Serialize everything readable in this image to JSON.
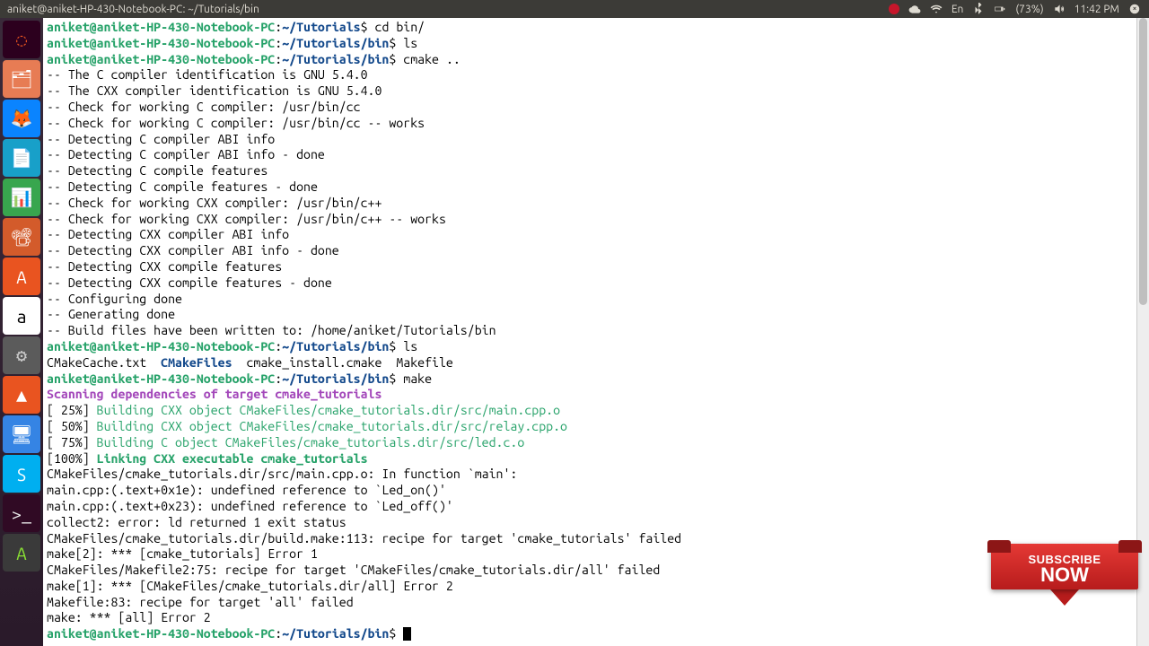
{
  "topbar": {
    "title": "aniket@aniket-HP-430-Notebook-PC: ~/Tutorials/bin",
    "lang": "En",
    "battery": "(73%)",
    "time": "11:42 PM"
  },
  "prompt": {
    "userhost": "aniket@aniket-HP-430-Notebook-PC",
    "sep": ":",
    "path1": "~/Tutorials",
    "path2": "~/Tutorials/bin",
    "dollar": "$"
  },
  "cmds": {
    "cd": " cd bin/",
    "ls": " ls",
    "cmake": " cmake ..",
    "make": " make"
  },
  "cmake_lines": [
    "-- The C compiler identification is GNU 5.4.0",
    "-- The CXX compiler identification is GNU 5.4.0",
    "-- Check for working C compiler: /usr/bin/cc",
    "-- Check for working C compiler: /usr/bin/cc -- works",
    "-- Detecting C compiler ABI info",
    "-- Detecting C compiler ABI info - done",
    "-- Detecting C compile features",
    "-- Detecting C compile features - done",
    "-- Check for working CXX compiler: /usr/bin/c++",
    "-- Check for working CXX compiler: /usr/bin/c++ -- works",
    "-- Detecting CXX compiler ABI info",
    "-- Detecting CXX compiler ABI info - done",
    "-- Detecting CXX compile features",
    "-- Detecting CXX compile features - done",
    "-- Configuring done",
    "-- Generating done",
    "-- Build files have been written to: /home/aniket/Tutorials/bin"
  ],
  "ls_out": {
    "a": "CMakeCache.txt  ",
    "b": "CMakeFiles",
    "c": "  cmake_install.cmake  Makefile"
  },
  "make": {
    "scan": "Scanning dependencies of target cmake_tutorials",
    "p25a": "[ 25%] ",
    "p25b": "Building CXX object CMakeFiles/cmake_tutorials.dir/src/main.cpp.o",
    "p50a": "[ 50%] ",
    "p50b": "Building CXX object CMakeFiles/cmake_tutorials.dir/src/relay.cpp.o",
    "p75a": "[ 75%] ",
    "p75b": "Building C object CMakeFiles/cmake_tutorials.dir/src/led.c.o",
    "p100a": "[100%] ",
    "p100b": "Linking CXX executable cmake_tutorials"
  },
  "errors": [
    "CMakeFiles/cmake_tutorials.dir/src/main.cpp.o: In function `main':",
    "main.cpp:(.text+0x1e): undefined reference to `Led_on()'",
    "main.cpp:(.text+0x23): undefined reference to `Led_off()'",
    "collect2: error: ld returned 1 exit status",
    "CMakeFiles/cmake_tutorials.dir/build.make:113: recipe for target 'cmake_tutorials' failed",
    "make[2]: *** [cmake_tutorials] Error 1",
    "CMakeFiles/Makefile2:75: recipe for target 'CMakeFiles/cmake_tutorials.dir/all' failed",
    "make[1]: *** [CMakeFiles/cmake_tutorials.dir/all] Error 2",
    "Makefile:83: recipe for target 'all' failed",
    "make: *** [all] Error 2"
  ],
  "launcher_icons": [
    {
      "name": "search-icon",
      "bg": "#2c001e",
      "glyph": "◌",
      "color": "#e95420"
    },
    {
      "name": "files-icon",
      "bg": "#e77c54",
      "glyph": "🗂",
      "color": "#fff"
    },
    {
      "name": "firefox-icon",
      "bg": "#0a84ff",
      "glyph": "🦊",
      "color": "#ff9500"
    },
    {
      "name": "writer-icon",
      "bg": "#18a0c9",
      "glyph": "📄",
      "color": "#fff"
    },
    {
      "name": "calc-icon",
      "bg": "#38a64e",
      "glyph": "📊",
      "color": "#fff"
    },
    {
      "name": "impress-icon",
      "bg": "#d35b2b",
      "glyph": "📽",
      "color": "#fff"
    },
    {
      "name": "software-icon",
      "bg": "#e95420",
      "glyph": "A",
      "color": "#fff"
    },
    {
      "name": "amazon-icon",
      "bg": "#fff",
      "glyph": "a",
      "color": "#000"
    },
    {
      "name": "settings-icon",
      "bg": "#5b5b5b",
      "glyph": "⚙",
      "color": "#ccc"
    },
    {
      "name": "vlc-icon",
      "bg": "#e95420",
      "glyph": "▲",
      "color": "#fff"
    },
    {
      "name": "monitor-icon",
      "bg": "#3584e4",
      "glyph": "🖥",
      "color": "#fff"
    },
    {
      "name": "skype-icon",
      "bg": "#00aff0",
      "glyph": "S",
      "color": "#fff"
    },
    {
      "name": "terminal-icon",
      "bg": "#300a24",
      "glyph": ">_",
      "color": "#eee"
    },
    {
      "name": "updater-icon",
      "bg": "#3a3a3a",
      "glyph": "A",
      "color": "#8ae234"
    }
  ],
  "subscribe": {
    "line1": "SUBSCRIBE",
    "line2": "NOW"
  }
}
